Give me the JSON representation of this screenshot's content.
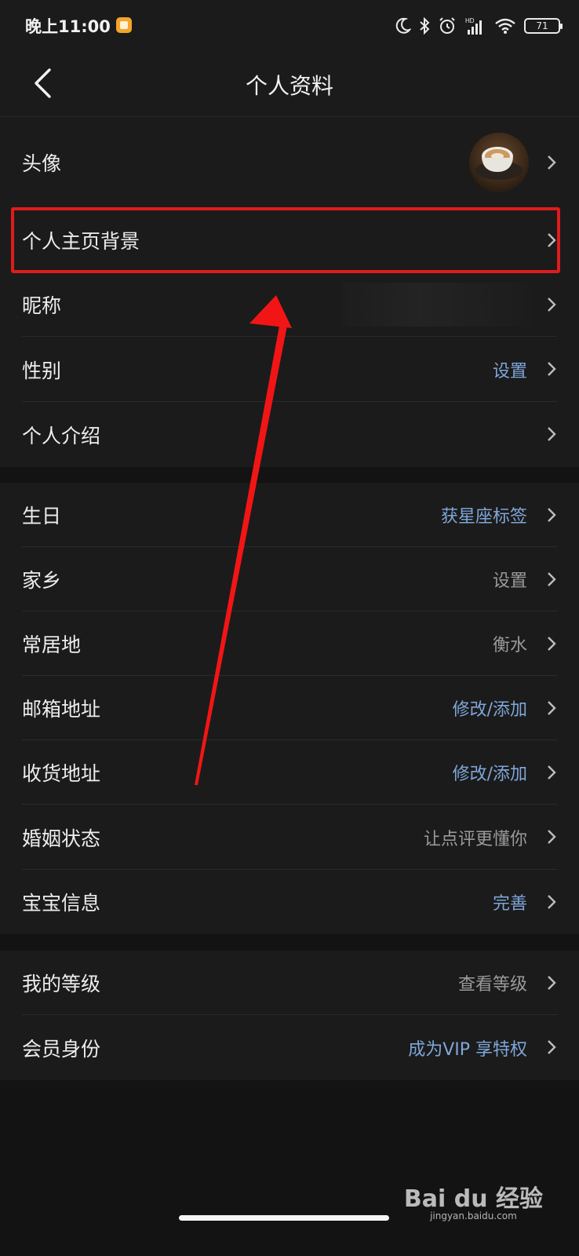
{
  "status_bar": {
    "time": "晚上11:00",
    "battery": "71",
    "network_label": "HD"
  },
  "header": {
    "title": "个人资料"
  },
  "section1": [
    {
      "label": "头像",
      "value": "",
      "type": "avatar"
    },
    {
      "label": "个人主页背景",
      "value": ""
    },
    {
      "label": "昵称",
      "value": "",
      "type": "blurred"
    },
    {
      "label": "性别",
      "value": "设置",
      "color": "blue"
    },
    {
      "label": "个人介绍",
      "value": ""
    }
  ],
  "section2": [
    {
      "label": "生日",
      "value": "获星座标签",
      "color": "blue"
    },
    {
      "label": "家乡",
      "value": "设置",
      "color": "gray"
    },
    {
      "label": "常居地",
      "value": "衡水",
      "color": "gray"
    },
    {
      "label": "邮箱地址",
      "value": "修改/添加",
      "color": "blue"
    },
    {
      "label": "收货地址",
      "value": "修改/添加",
      "color": "blue"
    },
    {
      "label": "婚姻状态",
      "value": "让点评更懂你",
      "color": "gray"
    },
    {
      "label": "宝宝信息",
      "value": "完善",
      "color": "blue"
    }
  ],
  "section3": [
    {
      "label": "我的等级",
      "value": "查看等级",
      "color": "gray"
    },
    {
      "label": "会员身份",
      "value": "成为VIP 享特权",
      "color": "blue"
    }
  ],
  "watermark": {
    "brand": "Bai du 经验",
    "url": "jingyan.baidu.com"
  },
  "colors": {
    "background": "#131313",
    "surface": "#1b1b1b",
    "accent_blue": "#7fa6d8",
    "highlight_red": "#e01b1b"
  }
}
